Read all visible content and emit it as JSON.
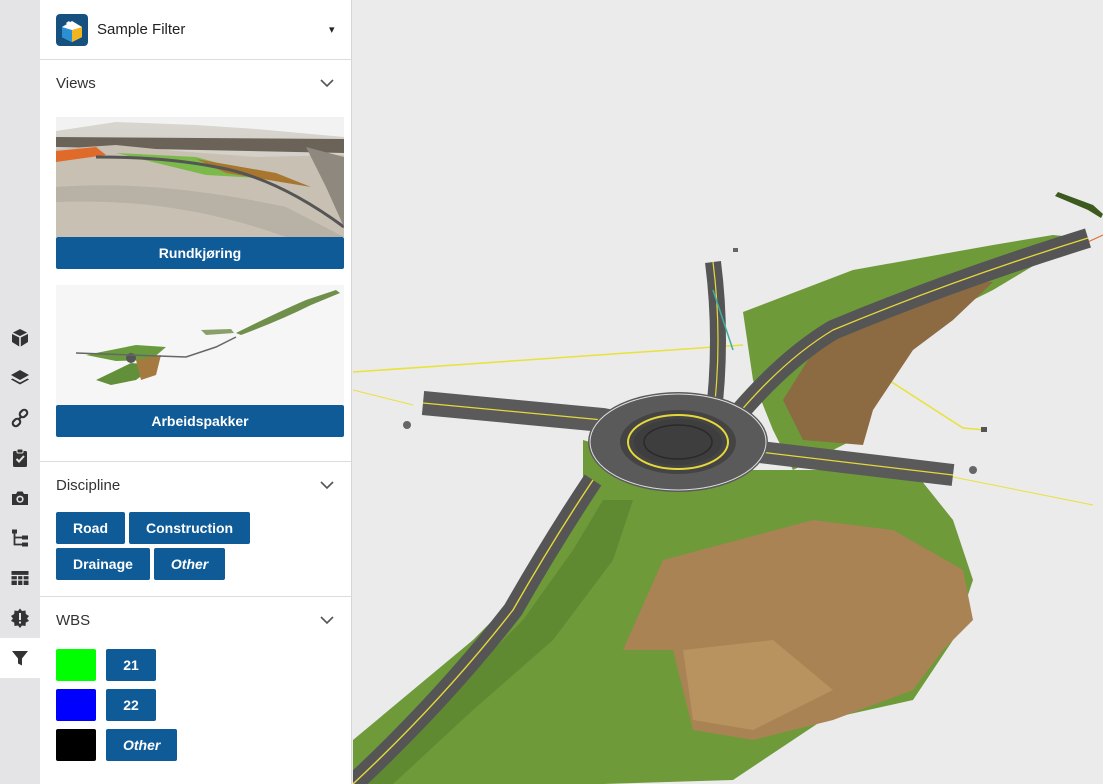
{
  "header": {
    "title": "Sample Filter",
    "caret": "▾"
  },
  "rail": {
    "items": [
      {
        "icon": "cube-icon"
      },
      {
        "icon": "layers-icon"
      },
      {
        "icon": "link-icon"
      },
      {
        "icon": "clipboard-check-icon"
      },
      {
        "icon": "camera-icon"
      },
      {
        "icon": "tree-structure-icon"
      },
      {
        "icon": "table-icon"
      },
      {
        "icon": "alert-badge-icon"
      },
      {
        "icon": "filter-icon",
        "active": true
      }
    ]
  },
  "views": {
    "title": "Views",
    "items": [
      {
        "label": "Rundkjøring"
      },
      {
        "label": "Arbeidspakker"
      }
    ]
  },
  "discipline": {
    "title": "Discipline",
    "tags": [
      "Road",
      "Construction",
      "Drainage",
      "Other"
    ]
  },
  "wbs": {
    "title": "WBS",
    "rows": [
      {
        "color": "#00ff00",
        "label": "21"
      },
      {
        "color": "#0000ff",
        "label": "22"
      },
      {
        "color": "#000000",
        "label": "Other"
      }
    ]
  },
  "colors": {
    "accent": "#0f5b97",
    "background": "#ebebeb",
    "rail": "#e4e4e6"
  }
}
